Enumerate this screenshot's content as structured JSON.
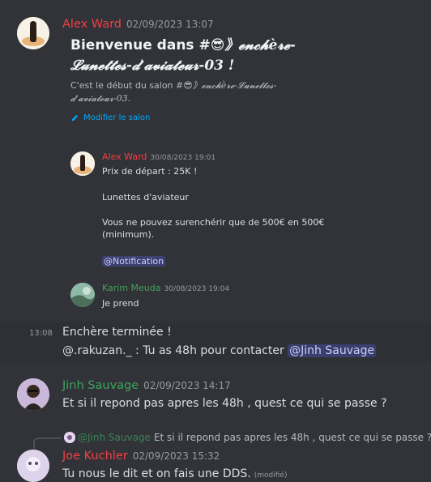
{
  "message1": {
    "author": "Alex Ward",
    "timestamp": "02/09/2023 13:07",
    "welcome_title_prefix": "Bienvenue dans #",
    "welcome_title_emoji": "😎",
    "welcome_title_channel": "》𝓮𝓷𝓬𝓱è𝓻𝓮-𝓛𝓾𝓷𝓮𝓽𝓽𝓮𝓼-𝓭'𝓪𝓿𝓲𝓪𝓽𝓮𝓾𝓻-03 !",
    "welcome_sub_prefix": "C'est le début du salon #",
    "welcome_sub_emoji": "😎",
    "welcome_sub_channel": "》𝓮𝓷𝓬𝓱è𝓻𝓮-𝓛𝓾𝓷𝓮𝓽𝓽𝓮𝓼-𝓭'𝓪𝓿𝓲𝓪𝓽𝓮𝓾𝓻-03.",
    "edit_channel_label": "Modifier le salon"
  },
  "embed1": {
    "author": "Alex Ward",
    "timestamp": "30/08/2023 19:01",
    "line1": "Prix de départ : 25K !",
    "line2": "Lunettes d'aviateur",
    "line3": "Vous ne pouvez surenchérir que de 500€ en 500€ (minimum).",
    "mention": "@Notification"
  },
  "embed2": {
    "author": "Karim Meuda",
    "timestamp": "30/08/2023 19:04",
    "line1": "Je prend"
  },
  "followup": {
    "timestamp": "13:08",
    "line1": "Enchère terminée !",
    "line2_prefix": "@.rakuzan._ : Tu as 48h pour contacter ",
    "line2_mention": "@Jinh Sauvage"
  },
  "message_jinh": {
    "author": "Jinh Sauvage",
    "timestamp": "02/09/2023 14:17",
    "text": "Et si il repond pas apres les 48h , quest ce qui se passe ?"
  },
  "reply_ref": {
    "author": "@Jinh Sauvage",
    "text": "Et si il repond pas apres les 48h , quest ce qui se passe ?"
  },
  "message_joe": {
    "author": "Joe Kuchler",
    "timestamp": "02/09/2023 15:32",
    "text": "Tu nous le dit et on fais une DDS.",
    "edited": "(modifié)"
  },
  "colors": {
    "background": "#313338",
    "accent_blue": "#00a8fc",
    "mention_bg": "#3c4270"
  }
}
